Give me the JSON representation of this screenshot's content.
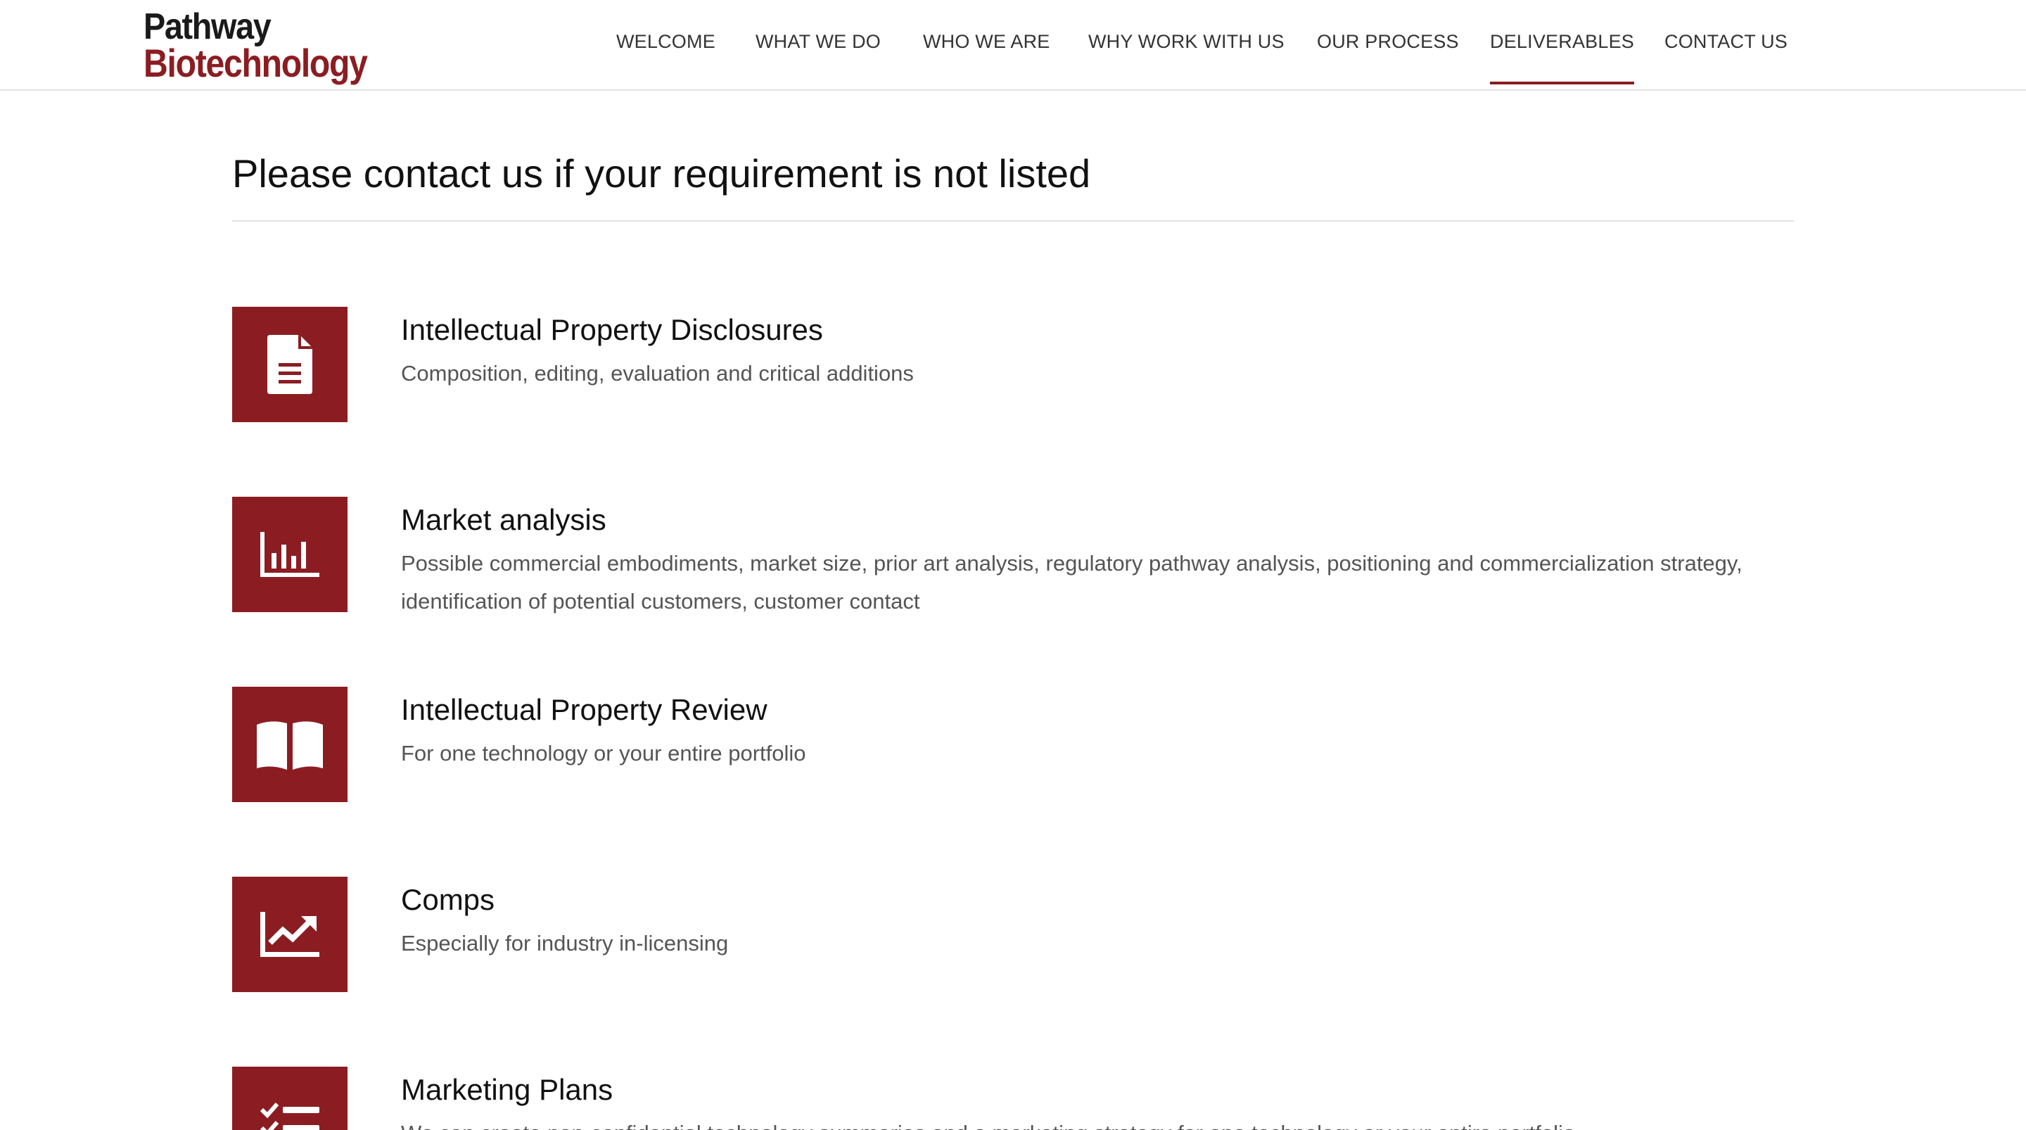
{
  "brand": {
    "line1": "Pathway",
    "line2": "Biotechnology",
    "accent_color": "#8b1d22"
  },
  "nav": {
    "items": [
      {
        "label": "WELCOME"
      },
      {
        "label": "WHAT WE DO"
      },
      {
        "label": "WHO WE ARE"
      },
      {
        "label": "WHY WORK WITH US"
      },
      {
        "label": "OUR PROCESS"
      },
      {
        "label": "DELIVERABLES",
        "active": true
      },
      {
        "label": "CONTACT US"
      }
    ]
  },
  "main": {
    "heading": "Please contact us if your requirement is not listed",
    "deliverables": [
      {
        "icon": "document-icon",
        "title": "Intellectual Property Disclosures",
        "description": "Composition, editing, evaluation and critical additions"
      },
      {
        "icon": "bar-chart-icon",
        "title": "Market analysis",
        "description": "Possible commercial embodiments, market size, prior art analysis, regulatory pathway analysis, positioning and commercialization strategy, identification of potential customers, customer contact"
      },
      {
        "icon": "open-book-icon",
        "title": "Intellectual Property Review",
        "description": "For one technology or your entire portfolio"
      },
      {
        "icon": "trending-chart-icon",
        "title": "Comps",
        "description": "Especially for industry in-licensing"
      },
      {
        "icon": "checklist-icon",
        "title": "Marketing Plans",
        "description": "We can create non-confidential technology summaries and a marketing strategy for one technology or your entire portfolio"
      }
    ]
  }
}
